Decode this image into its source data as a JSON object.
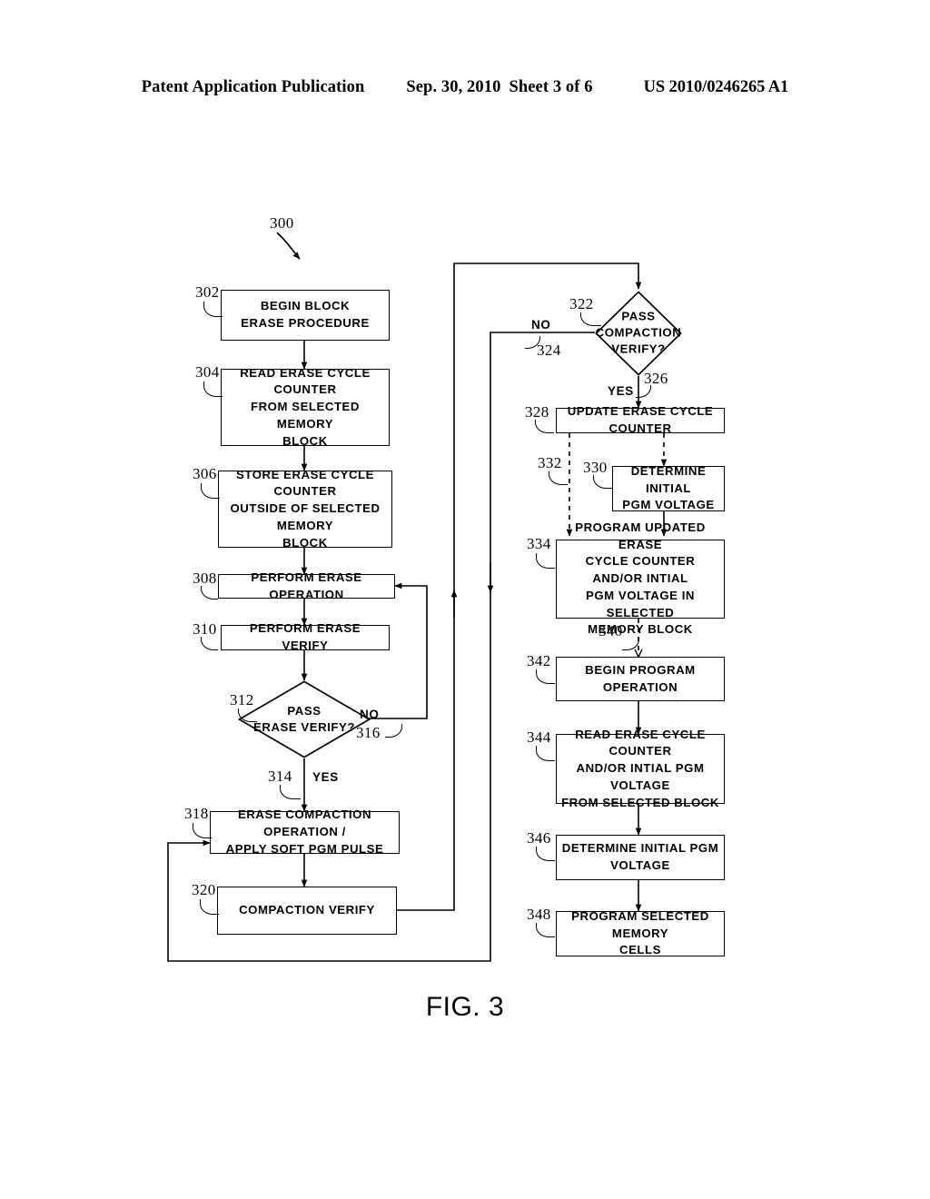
{
  "header": {
    "publication": "Patent Application Publication",
    "date": "Sep. 30, 2010",
    "sheet": "Sheet 3 of 6",
    "patent_number": "US 2010/0246265 A1"
  },
  "figure": {
    "caption": "FIG. 3",
    "diagram_ref": "300"
  },
  "nodes": [
    {
      "ref": "302",
      "shape": "process",
      "text": "BEGIN BLOCK\nERASE PROCEDURE"
    },
    {
      "ref": "304",
      "shape": "process",
      "text": "READ ERASE CYCLE COUNTER\nFROM SELECTED MEMORY\nBLOCK"
    },
    {
      "ref": "306",
      "shape": "process",
      "text": "STORE ERASE CYCLE COUNTER\nOUTSIDE OF SELECTED MEMORY\nBLOCK"
    },
    {
      "ref": "308",
      "shape": "process",
      "text": "PERFORM ERASE OPERATION"
    },
    {
      "ref": "310",
      "shape": "process",
      "text": "PERFORM ERASE VERIFY"
    },
    {
      "ref": "312",
      "shape": "decision",
      "text": "PASS\nERASE VERIFY?"
    },
    {
      "ref": "318",
      "shape": "process",
      "text": "ERASE COMPACTION OPERATION /\nAPPLY SOFT PGM PULSE"
    },
    {
      "ref": "320",
      "shape": "process",
      "text": "COMPACTION VERIFY"
    },
    {
      "ref": "322",
      "shape": "decision",
      "text": "PASS\nCOMPACTION\nVERIFY?"
    },
    {
      "ref": "328",
      "shape": "process",
      "text": "UPDATE ERASE CYCLE COUNTER"
    },
    {
      "ref": "330",
      "shape": "process",
      "text": "DETERMINE INITIAL\nPGM VOLTAGE"
    },
    {
      "ref": "334",
      "shape": "process",
      "text": "PROGRAM UPDATED ERASE\nCYCLE COUNTER AND/OR INTIAL\nPGM VOLTAGE IN SELECTED\nMEMORY BLOCK"
    },
    {
      "ref": "342",
      "shape": "process",
      "text": "BEGIN PROGRAM OPERATION"
    },
    {
      "ref": "344",
      "shape": "process",
      "text": "READ ERASE CYCLE COUNTER\nAND/OR INTIAL PGM VOLTAGE\nFROM SELECTED BLOCK"
    },
    {
      "ref": "346",
      "shape": "process",
      "text": "DETERMINE INITIAL PGM\nVOLTAGE"
    },
    {
      "ref": "348",
      "shape": "process",
      "text": "PROGRAM SELECTED MEMORY\nCELLS"
    }
  ],
  "edges": [
    {
      "ref": "314",
      "label": "YES",
      "from": "312",
      "to": "318"
    },
    {
      "ref": "316",
      "label": "NO",
      "from": "312",
      "to": "308"
    },
    {
      "ref": "324",
      "label": "NO",
      "from": "322",
      "to": "318"
    },
    {
      "ref": "326",
      "label": "YES",
      "from": "322",
      "to": "328"
    },
    {
      "ref": "332",
      "label": "",
      "from": "328",
      "to": "334"
    },
    {
      "ref": "340",
      "label": "",
      "from": "334",
      "to": "342"
    }
  ],
  "labels": {
    "yes": "YES",
    "no": "NO"
  },
  "colors": {
    "ink": "#000000",
    "paper": "#ffffff"
  }
}
